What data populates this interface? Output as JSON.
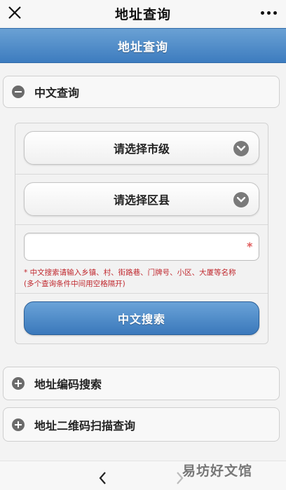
{
  "window": {
    "title": "地址查询",
    "close_icon": "close-icon",
    "more_icon": "more-dots-icon"
  },
  "header": {
    "title": "地址查询"
  },
  "sections": {
    "chinese_query": {
      "label": "中文查询",
      "icon": "minus-circle-icon",
      "expanded": true,
      "city_select": "请选择市级",
      "district_select": "请选择区县",
      "input_value": "",
      "required_mark": "*",
      "hint_line1": "* 中文搜索请输入乡镇、村、街路巷、门牌号、小区、大厦等名称",
      "hint_line2": "(多个查询条件中间用空格隔开)",
      "search_button": "中文搜索"
    },
    "code_search": {
      "label": "地址编码搜索",
      "icon": "plus-circle-icon",
      "expanded": false
    },
    "qr_scan": {
      "label": "地址二维码扫描查询",
      "icon": "plus-circle-icon",
      "expanded": false
    }
  },
  "bottom_nav": {
    "back_icon": "chevron-left-icon",
    "forward_icon": "chevron-right-icon"
  },
  "watermark": "易坊好文馆",
  "colors": {
    "accent": "#3d7cbf",
    "hint_text": "#c0282e",
    "required_star": "#e05a5a"
  }
}
